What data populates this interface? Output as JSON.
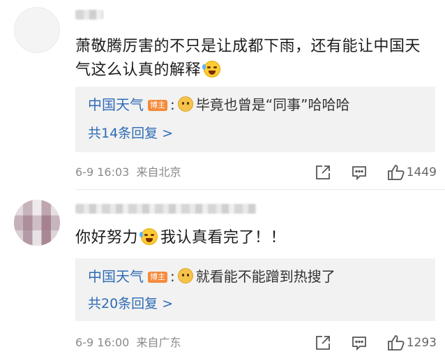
{
  "comments": [
    {
      "text": "萧敬腾厉害的不只是让成都下雨，还有能让中国天气这么认真的解释",
      "emoji": "laugh-tears-emoji",
      "reply": {
        "author": "中国天气",
        "badge": "博主",
        "colon": ":",
        "text": "毕竟也曾是“同事”哈哈哈"
      },
      "more_replies": "共14条回复 >",
      "date": "6-9 16:03",
      "source": "来自北京",
      "likes": "1449"
    },
    {
      "text": "你好努力",
      "text_after": "我认真看完了！！",
      "emoji": "crying-laughing-emoji",
      "reply": {
        "author": "中国天气",
        "badge": "博主",
        "colon": ":",
        "text": "就看能不能蹭到热搜了"
      },
      "more_replies": "共20条回复 >",
      "date": "6-9 16:00",
      "source": "来自广东",
      "likes": "1293"
    }
  ],
  "colors": {
    "link": "#2e6bb5",
    "badge": "#f58a3a",
    "reply_bg": "#f2f2f2",
    "meta": "#8a8a8a"
  }
}
